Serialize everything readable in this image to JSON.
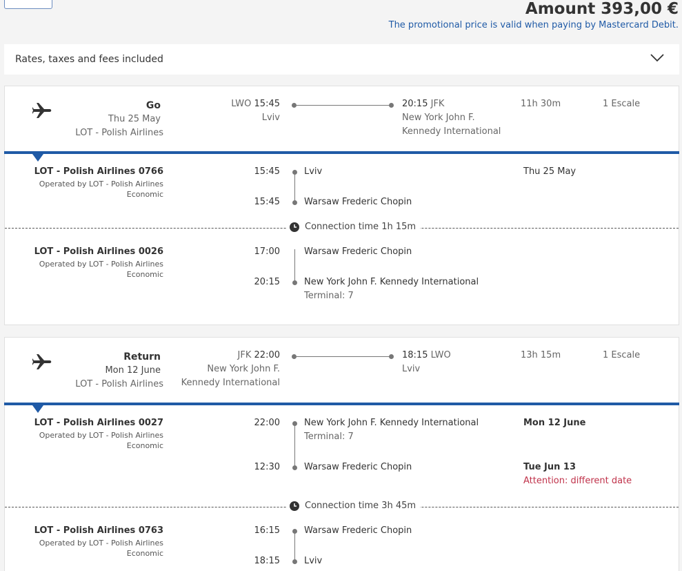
{
  "header": {
    "amount": "Amount 393,00 €",
    "promo": "The promotional price is valid when paying by Mastercard Debit."
  },
  "rates": {
    "label": "Rates, taxes and fees included"
  },
  "icons": {
    "plane": "plane-icon",
    "clock": "clock-icon",
    "chevron": "chevron-down-icon"
  },
  "colors": {
    "accent": "#1f5aa6",
    "warning": "#c0324a"
  },
  "go": {
    "direction": "Go",
    "date": "Thu 25 May",
    "airline": "LOT - Polish Airlines",
    "dep_code": "LWO",
    "dep_time": "15:45",
    "dep_city": "Lviv",
    "arr_time": "20:15",
    "arr_code": "JFK",
    "arr_city_1": "New York John F.",
    "arr_city_2": "Kennedy International",
    "duration": "11h 30m",
    "stops": "1 Escale",
    "flights": [
      {
        "name": "LOT - Polish Airlines 0766",
        "operated": "Operated by LOT - Polish Airlines",
        "class": "Economic",
        "dep_time": "15:45",
        "dep_place": "Lviv",
        "dep_date": "Thu 25 May",
        "arr_time": "15:45",
        "arr_place": "Warsaw Frederic Chopin"
      },
      {
        "name": "LOT - Polish Airlines 0026",
        "operated": "Operated by LOT - Polish Airlines",
        "class": "Economic",
        "dep_time": "17:00",
        "dep_place": "Warsaw Frederic Chopin",
        "arr_time": "20:15",
        "arr_place": "New York John F. Kennedy International",
        "arr_terminal": "Terminal: 7"
      }
    ],
    "connection": "Connection time 1h 15m"
  },
  "ret": {
    "direction": "Return",
    "date": "Mon 12 June",
    "airline": "LOT - Polish Airlines",
    "dep_code": "JFK",
    "dep_time": "22:00",
    "dep_city_1": "New York John F.",
    "dep_city_2": "Kennedy International",
    "arr_time": "18:15",
    "arr_code": "LWO",
    "arr_city": "Lviv",
    "duration": "13h 15m",
    "stops": "1 Escale",
    "flights": [
      {
        "name": "LOT - Polish Airlines 0027",
        "operated": "Operated by LOT - Polish Airlines",
        "class": "Economic",
        "dep_time": "22:00",
        "dep_place": "New York John F. Kennedy International",
        "dep_terminal": "Terminal: 7",
        "dep_date": "Mon 12 June",
        "arr_time": "12:30",
        "arr_place": "Warsaw Frederic Chopin",
        "arr_date": "Tue Jun 13",
        "arr_warning": "Attention: different date"
      },
      {
        "name": "LOT - Polish Airlines 0763",
        "operated": "Operated by LOT - Polish Airlines",
        "class": "Economic",
        "dep_time": "16:15",
        "dep_place": "Warsaw Frederic Chopin",
        "arr_time": "18:15",
        "arr_place": "Lviv"
      }
    ],
    "connection": "Connection time 3h 45m"
  }
}
